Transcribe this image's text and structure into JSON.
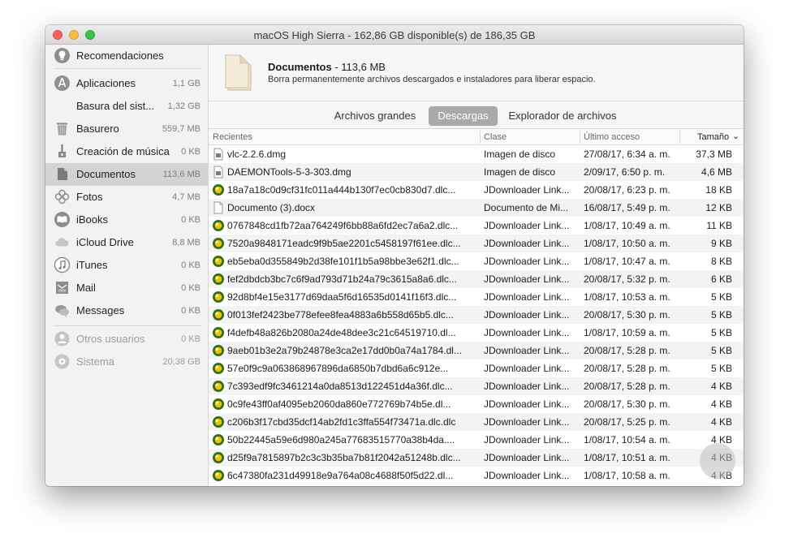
{
  "window": {
    "title": "macOS High Sierra - 162,86 GB disponible(s) de 186,35 GB"
  },
  "sidebar": {
    "items": [
      {
        "label": "Recomendaciones",
        "size": "",
        "icon": "lightbulb-icon"
      },
      {
        "label": "Aplicaciones",
        "size": "1,1 GB",
        "icon": "app-store-icon"
      },
      {
        "label": "Basura del sist...",
        "size": "1,32 GB",
        "icon": ""
      },
      {
        "label": "Basurero",
        "size": "559,7 MB",
        "icon": "trash-icon"
      },
      {
        "label": "Creación de música",
        "size": "0 KB",
        "icon": "guitar-icon"
      },
      {
        "label": "Documentos",
        "size": "113,6 MB",
        "icon": "document-icon"
      },
      {
        "label": "Fotos",
        "size": "4,7 MB",
        "icon": "photos-icon"
      },
      {
        "label": "iBooks",
        "size": "0 KB",
        "icon": "ibooks-icon"
      },
      {
        "label": "iCloud Drive",
        "size": "8,8 MB",
        "icon": "cloud-icon"
      },
      {
        "label": "iTunes",
        "size": "0 KB",
        "icon": "music-note-icon"
      },
      {
        "label": "Mail",
        "size": "0 KB",
        "icon": "mail-icon"
      },
      {
        "label": "Messages",
        "size": "0 KB",
        "icon": "messages-icon"
      },
      {
        "label": "Otros usuarios",
        "size": "0 KB",
        "icon": "users-icon"
      },
      {
        "label": "Sistema",
        "size": "20,38 GB",
        "icon": "system-icon"
      }
    ],
    "selected": "Documentos"
  },
  "header": {
    "title": "Documentos",
    "size": " - 113,6 MB",
    "description": "Borra permanentemente archivos descargados e instaladores para liberar espacio."
  },
  "tabs": [
    {
      "label": "Archivos grandes"
    },
    {
      "label": "Descargas"
    },
    {
      "label": "Explorador de archivos"
    }
  ],
  "active_tab": "Descargas",
  "table": {
    "columns": [
      "Recientes",
      "Clase",
      "Último acceso",
      "Tamaño"
    ],
    "sort_indicator": "⌄",
    "rows": [
      {
        "icon": "dmg-file-icon",
        "name": "vlc-2.2.6.dmg",
        "class": "Imagen de disco",
        "date": "27/08/17, 6:34 a. m.",
        "size": "37,3 MB"
      },
      {
        "icon": "dmg-file-icon",
        "name": "DAEMONTools-5-3-303.dmg",
        "class": "Imagen de disco",
        "date": "2/09/17, 6:50 p. m.",
        "size": "4,6 MB"
      },
      {
        "icon": "jdownloader-icon",
        "name": "18a7a18c0d9cf31fc011a444b130f7ec0cb830d7.dlc...",
        "class": "JDownloader Link...",
        "date": "20/08/17, 6:23 p. m.",
        "size": "18 KB"
      },
      {
        "icon": "document-icon",
        "name": "Documento (3).docx",
        "class": "Documento de Mi...",
        "date": "16/08/17, 5:49 p. m.",
        "size": "12 KB"
      },
      {
        "icon": "jdownloader-icon",
        "name": "0767848cd1fb72aa764249f6bb88a6fd2ec7a6a2.dlc...",
        "class": "JDownloader Link...",
        "date": "1/08/17, 10:49 a. m.",
        "size": "11 KB"
      },
      {
        "icon": "jdownloader-icon",
        "name": "7520a9848171eadc9f9b5ae2201c5458197f61ee.dlc...",
        "class": "JDownloader Link...",
        "date": "1/08/17, 10:50 a. m.",
        "size": "9 KB"
      },
      {
        "icon": "jdownloader-icon",
        "name": "eb5eba0d355849b2d38fe101f1b5a98bbe3e62f1.dlc...",
        "class": "JDownloader Link...",
        "date": "1/08/17, 10:47 a. m.",
        "size": "8 KB"
      },
      {
        "icon": "jdownloader-icon",
        "name": "fef2dbdcb3bc7c6f9ad793d71b24a79c3615a8a6.dlc...",
        "class": "JDownloader Link...",
        "date": "20/08/17, 5:32 p. m.",
        "size": "6 KB"
      },
      {
        "icon": "jdownloader-icon",
        "name": "92d8bf4e15e3177d69daa5f6d16535d0141f16f3.dlc...",
        "class": "JDownloader Link...",
        "date": "1/08/17, 10:53 a. m.",
        "size": "5 KB"
      },
      {
        "icon": "jdownloader-icon",
        "name": "0f013fef2423be778efee8fea4883a6b558d65b5.dlc...",
        "class": "JDownloader Link...",
        "date": "20/08/17, 5:30 p. m.",
        "size": "5 KB"
      },
      {
        "icon": "jdownloader-icon",
        "name": "f4defb48a826b2080a24de48dee3c21c64519710.dl...",
        "class": "JDownloader Link...",
        "date": "1/08/17, 10:59 a. m.",
        "size": "5 KB"
      },
      {
        "icon": "jdownloader-icon",
        "name": "9aeb01b3e2a79b24878e3ca2e17dd0b0a74a1784.dl...",
        "class": "JDownloader Link...",
        "date": "20/08/17, 5:28 p. m.",
        "size": "5 KB"
      },
      {
        "icon": "jdownloader-icon",
        "name": "57e0f9c9a063868967896da6850b7dbd6a6c912e...",
        "class": "JDownloader Link...",
        "date": "20/08/17, 5:28 p. m.",
        "size": "5 KB"
      },
      {
        "icon": "jdownloader-icon",
        "name": "7c393edf9fc3461214a0da8513d122451d4a36f.dlc...",
        "class": "JDownloader Link...",
        "date": "20/08/17, 5:28 p. m.",
        "size": "4 KB"
      },
      {
        "icon": "jdownloader-icon",
        "name": "0c9fe43ff0af4095eb2060da860e772769b74b5e.dl...",
        "class": "JDownloader Link...",
        "date": "20/08/17, 5:30 p. m.",
        "size": "4 KB"
      },
      {
        "icon": "jdownloader-icon",
        "name": "c206b3f17cbd35dcf14ab2fd1c3ffa554f73471a.dlc.dlc",
        "class": "JDownloader Link...",
        "date": "20/08/17, 5:25 p. m.",
        "size": "4 KB"
      },
      {
        "icon": "jdownloader-icon",
        "name": "50b22445a59e6d980a245a77683515770a38b4da....",
        "class": "JDownloader Link...",
        "date": "1/08/17, 10:54 a. m.",
        "size": "4 KB"
      },
      {
        "icon": "jdownloader-icon",
        "name": "d25f9a7815897b2c3c3b35ba7b81f2042a51248b.dlc...",
        "class": "JDownloader Link...",
        "date": "1/08/17, 10:51 a. m.",
        "size": "4 KB"
      },
      {
        "icon": "jdownloader-icon",
        "name": "6c47380fa231d49918e9a764a08c4688f50f5d22.dl...",
        "class": "JDownloader Link...",
        "date": "1/08/17, 10:58 a. m.",
        "size": "4 KB"
      }
    ]
  }
}
